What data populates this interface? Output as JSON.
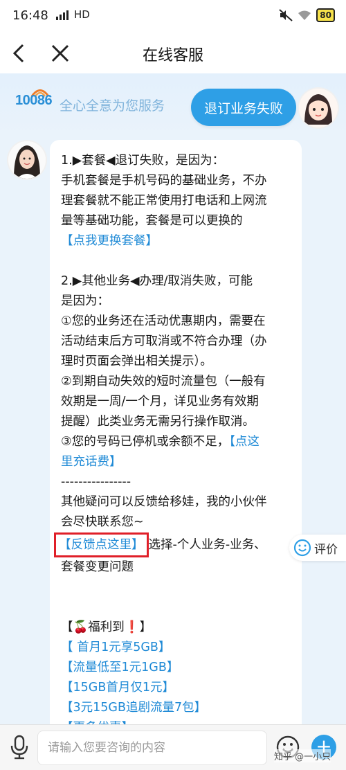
{
  "status_bar": {
    "time": "16:48",
    "network": "HD",
    "battery": "80"
  },
  "header": {
    "title": "在线客服"
  },
  "banner": {
    "logo": "10086",
    "slogan": "全心全意为您服务"
  },
  "user_message": "退订业务失败",
  "agent_message": {
    "lines": [
      {
        "t": "1.▶套餐◀退订失败，是因为："
      },
      {
        "t": "手机套餐是手机号码的基础业务，不办"
      },
      {
        "t": "理套餐就不能正常使用打电话和上网流"
      },
      {
        "t": "量等基础功能，套餐是可以更换的"
      },
      {
        "t": "【点我更换套餐】"
      },
      {
        "t": ""
      },
      {
        "t": "2.▶其他业务◀办理/取消失败，可能"
      },
      {
        "t": "是因为："
      },
      {
        "t": "①您的业务还在活动优惠期内，需要在"
      },
      {
        "t": "活动结束后方可取消或不符合办理（办"
      },
      {
        "t": "理时页面会弹出相关提示）。"
      },
      {
        "t": "②到期自动失效的短时流量包（一般有"
      },
      {
        "t": "效期是一周/一个月，详见业务有效期"
      },
      {
        "t": "提醒）此类业务无需另行操作取消。"
      },
      {
        "t": "③您的号码已停机或余额不足，"
      },
      {
        "t": "【点这"
      },
      {
        "t": "里充话费】"
      },
      {
        "t": "----------------"
      },
      {
        "t": "其他疑问可以反馈给移娃，我的小伙伴"
      },
      {
        "t": "会尽快联系您~"
      },
      {
        "t": "【反馈点这里】"
      },
      {
        "t": "选择-个人业务-业务、"
      },
      {
        "t": "套餐变更问题"
      },
      {
        "t": ""
      },
      {
        "t": ""
      },
      {
        "t": "【🍒福利到❗】"
      },
      {
        "t": "【 首月1元享5GB】"
      },
      {
        "t": "【流量低至1元1GB】"
      },
      {
        "t": "【15GB首月仅1元】"
      },
      {
        "t": "【3元15GB追剧流量7包】"
      },
      {
        "t": "【更多优惠】"
      }
    ]
  },
  "rating": {
    "label": "评价"
  },
  "input": {
    "placeholder": "请输入您要咨询的内容"
  },
  "watermark": "知乎 @一小只"
}
